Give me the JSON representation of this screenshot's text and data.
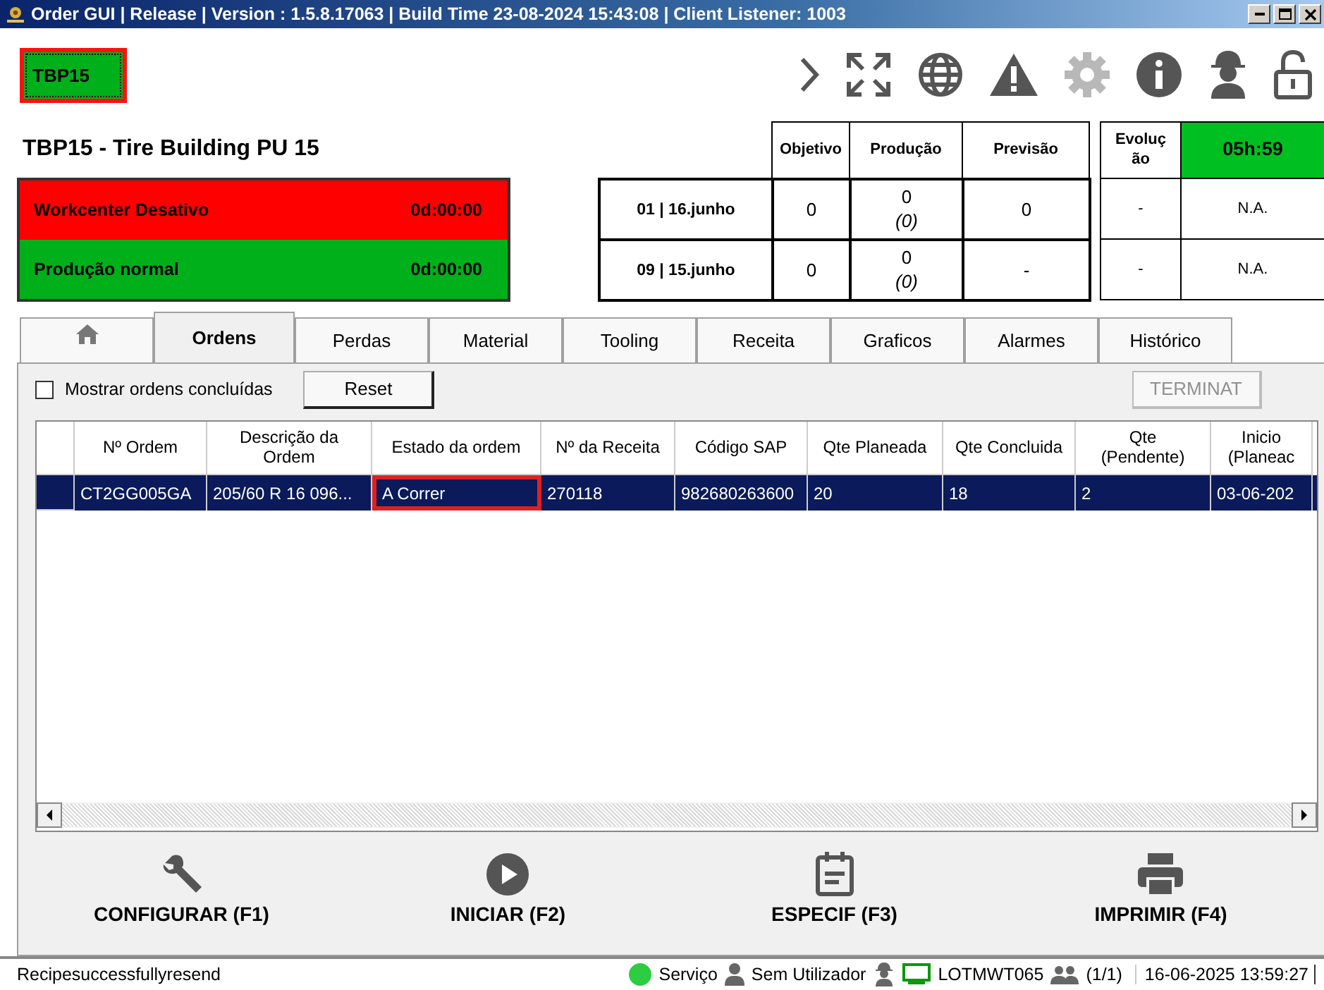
{
  "window": {
    "title": "Order GUI | Release | Version : 1.5.8.17063 | Build Time 23-08-2024 15:43:08 | Client Listener: 1003"
  },
  "header": {
    "station_badge": "TBP15",
    "station_title": "TBP15 - Tire Building PU 15",
    "toolbar": [
      {
        "kind": "chevron",
        "disabled": false
      },
      {
        "kind": "expand",
        "disabled": false
      },
      {
        "kind": "globe",
        "disabled": false
      },
      {
        "kind": "warning",
        "disabled": false
      },
      {
        "kind": "gear",
        "disabled": true
      },
      {
        "kind": "info",
        "disabled": false
      },
      {
        "kind": "worker",
        "disabled": false
      },
      {
        "kind": "lock",
        "disabled": false
      }
    ]
  },
  "status_panels": [
    {
      "label": "Workcenter Desativo",
      "time": "0d:00:00",
      "color": "#ff0000"
    },
    {
      "label": "Produção normal",
      "time": "0d:00:00",
      "color": "#00b01a"
    }
  ],
  "shift_table": {
    "columns": [
      "Objetivo",
      "Produção",
      "Previsão"
    ],
    "evolution_header": "Evolução",
    "evolution_value": "05h:59",
    "rows": [
      {
        "shift": "01 | 16.junho",
        "objective": "0",
        "production": "0",
        "production_sub": "(0)",
        "forecast": "0",
        "evolution": "-",
        "value": "N.A."
      },
      {
        "shift": "09 | 15.junho",
        "objective": "0",
        "production": "0",
        "production_sub": "(0)",
        "forecast": "-",
        "evolution": "-",
        "value": "N.A."
      }
    ]
  },
  "tabs": [
    {
      "kind": "home",
      "selected": false
    },
    {
      "kind": "text",
      "label": "Ordens",
      "selected": true
    },
    {
      "kind": "text",
      "label": "Perdas",
      "selected": false
    },
    {
      "kind": "text",
      "label": "Material",
      "selected": false
    },
    {
      "kind": "text",
      "label": "Tooling",
      "selected": false
    },
    {
      "kind": "text",
      "label": "Receita",
      "selected": false
    },
    {
      "kind": "text",
      "label": "Graficos",
      "selected": false
    },
    {
      "kind": "text",
      "label": "Alarmes",
      "selected": false
    },
    {
      "kind": "text",
      "label": "Histórico",
      "selected": false
    }
  ],
  "orders": {
    "show_completed": {
      "label": "Mostrar ordens concluídas",
      "checked": false
    },
    "reset_button": "Reset",
    "terminate_button": {
      "label": "TERMINAT",
      "disabled": true
    },
    "columns": [
      "Nº Ordem",
      "Descrição da Ordem",
      "Estado da ordem",
      "Nº da Receita",
      "Código SAP",
      "Qte Planeada",
      "Qte Concluida",
      "Qte (Pendente)",
      "Inicio (Planeac"
    ],
    "rows": [
      {
        "selected": true,
        "cells": [
          {
            "text": "CT2GG005GA",
            "focused": false
          },
          {
            "text": "205/60 R 16 096...",
            "focused": false
          },
          {
            "text": "A Correr",
            "focused": true
          },
          {
            "text": "270118",
            "focused": false
          },
          {
            "text": "982680263600",
            "focused": false
          },
          {
            "text": "20",
            "focused": false
          },
          {
            "text": "18",
            "focused": false
          },
          {
            "text": "2",
            "focused": false
          },
          {
            "text": "03-06-202",
            "focused": false
          }
        ]
      }
    ]
  },
  "actions": [
    {
      "kind": "wrench",
      "label": "CONFIGURAR (F1)"
    },
    {
      "kind": "play",
      "label": "INICIAR (F2)"
    },
    {
      "kind": "spec",
      "label": "ESPECIF (F3)"
    },
    {
      "kind": "printer",
      "label": "IMPRIMIR (F4)"
    }
  ],
  "status_bar": {
    "message": "Recipesuccessfullyresend",
    "service": {
      "label": "Serviço",
      "color": "#2ecc40"
    },
    "user": "Sem Utilizador",
    "station": "LOTMWT065",
    "sessions": "(1/1)",
    "datetime": "16-06-2025 13:59:27"
  }
}
